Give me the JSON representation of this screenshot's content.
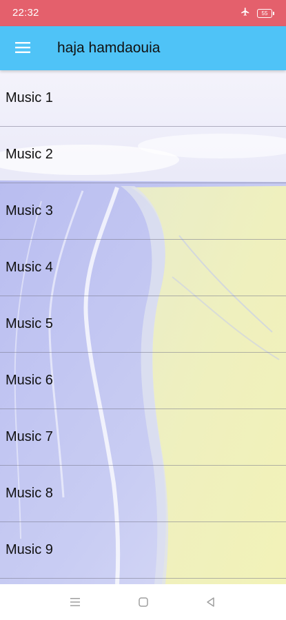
{
  "status_bar": {
    "time": "22:32",
    "battery_level": "55",
    "icons": [
      "airplane-icon",
      "battery-icon"
    ],
    "color": "#e4606c"
  },
  "app_bar": {
    "title": "haja hamdaouia",
    "menu_icon": "hamburger-menu-icon",
    "color": "#4fc3f7"
  },
  "list": {
    "items": [
      {
        "label": "Music 1"
      },
      {
        "label": "Music 2"
      },
      {
        "label": "Music 3"
      },
      {
        "label": "Music 4"
      },
      {
        "label": "Music 5"
      },
      {
        "label": "Music 6"
      },
      {
        "label": "Music 7"
      },
      {
        "label": "Music 8"
      },
      {
        "label": "Music 9"
      }
    ]
  },
  "nav_bar": {
    "icons": [
      "recent-apps-icon",
      "home-icon",
      "back-icon"
    ]
  }
}
